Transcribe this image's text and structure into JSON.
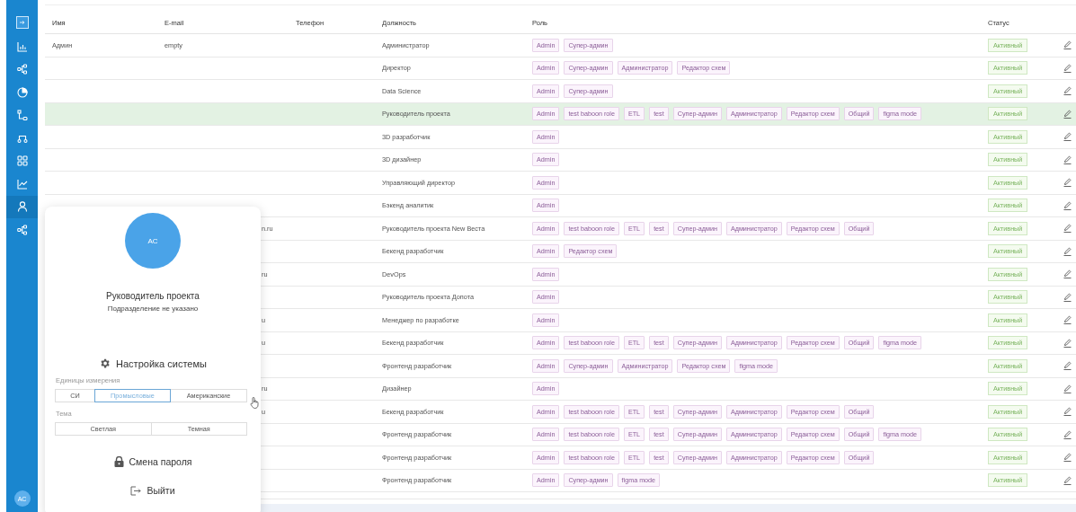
{
  "sidebar": {
    "items": [
      {
        "kind": "bar-chart",
        "selected": false
      },
      {
        "kind": "nodes",
        "selected": false
      },
      {
        "kind": "pie",
        "selected": false
      },
      {
        "kind": "flow",
        "selected": false
      },
      {
        "kind": "route",
        "selected": false
      },
      {
        "kind": "grid",
        "selected": false
      },
      {
        "kind": "line-chart",
        "selected": false
      },
      {
        "kind": "user",
        "selected": true
      },
      {
        "kind": "nodes",
        "selected": false
      }
    ],
    "avatar": "AC"
  },
  "table": {
    "columns": [
      "Имя",
      "E-mail",
      "Телефон",
      "Должность",
      "Роль",
      "Статус"
    ],
    "rows": [
      {
        "name": "Админ",
        "email": "empty",
        "position": "Администратор",
        "roles": [
          "Admin",
          "Супер-админ"
        ],
        "status": "Активный",
        "selected": false
      },
      {
        "position": "Директор",
        "roles": [
          "Admin",
          "Супер-админ",
          "Администратор",
          "Редактор схем"
        ],
        "status": "Активный",
        "selected": false
      },
      {
        "position": "Data Science",
        "roles": [
          "Admin",
          "Супер-админ"
        ],
        "status": "Активный",
        "selected": false
      },
      {
        "position": "Руководитель проекта",
        "roles": [
          "Admin",
          "test baboon role",
          "ETL",
          "test",
          "Супер-админ",
          "Администратор",
          "Редактор схем",
          "Общий",
          "figma mode"
        ],
        "status": "Активный",
        "selected": true
      },
      {
        "position": "3D разработчик",
        "roles": [
          "Admin"
        ],
        "status": "Активный",
        "selected": false
      },
      {
        "position": "3D дизайнер",
        "roles": [
          "Admin"
        ],
        "status": "Активный",
        "selected": false
      },
      {
        "position": "Управляющий директор",
        "roles": [
          "Admin"
        ],
        "status": "Активный",
        "selected": false
      },
      {
        "position": "Бэкенд аналитик",
        "roles": [
          "Admin"
        ],
        "status": "Активный",
        "selected": false
      },
      {
        "email_tail": "n.ru",
        "position": "Руководитель проекта New Веста",
        "roles": [
          "Admin",
          "test baboon role",
          "ETL",
          "test",
          "Супер-админ",
          "Администратор",
          "Редактор схем",
          "Общий"
        ],
        "status": "Активный",
        "selected": false
      },
      {
        "position": "Бекенд разработчик",
        "roles": [
          "Admin",
          "Редактор схем"
        ],
        "status": "Активный",
        "selected": false
      },
      {
        "email_tail": "ru",
        "position": "DevOps",
        "roles": [
          "Admin"
        ],
        "status": "Активный",
        "selected": false
      },
      {
        "position": "Руководитель проекта Допота",
        "roles": [
          "Admin"
        ],
        "status": "Активный",
        "selected": false
      },
      {
        "email_tail": "u",
        "position": "Менеджер по разработке",
        "roles": [
          "Admin"
        ],
        "status": "Активный",
        "selected": false
      },
      {
        "email_tail": "u",
        "position": "Бекенд разработчик",
        "roles": [
          "Admin",
          "test baboon role",
          "ETL",
          "test",
          "Супер-админ",
          "Администратор",
          "Редактор схем",
          "Общий",
          "figma mode"
        ],
        "status": "Активный",
        "selected": false
      },
      {
        "position": "Фронтенд разработчик",
        "roles": [
          "Admin",
          "Супер-админ",
          "Администратор",
          "Редактор схем",
          "figma mode"
        ],
        "status": "Активный",
        "selected": false
      },
      {
        "email_tail": "ru",
        "position": "Дизайнер",
        "roles": [
          "Admin"
        ],
        "status": "Активный",
        "selected": false
      },
      {
        "email_tail": "u",
        "position": "Бекенд разработчик",
        "roles": [
          "Admin",
          "test baboon role",
          "ETL",
          "test",
          "Супер-админ",
          "Администратор",
          "Редактор схем",
          "Общий"
        ],
        "status": "Активный",
        "selected": false
      },
      {
        "position": "Фронтенд разработчик",
        "roles": [
          "Admin",
          "test baboon role",
          "ETL",
          "test",
          "Супер-админ",
          "Администратор",
          "Редактор схем",
          "Общий",
          "figma mode"
        ],
        "status": "Активный",
        "selected": false
      },
      {
        "position": "Фронтенд разработчик",
        "roles": [
          "Admin",
          "test baboon role",
          "ETL",
          "test",
          "Супер-админ",
          "Администратор",
          "Редактор схем",
          "Общий"
        ],
        "status": "Активный",
        "selected": false
      },
      {
        "position": "Фронтенд разработчик",
        "roles": [
          "Admin",
          "Супер-админ",
          "figma mode"
        ],
        "status": "Активный",
        "selected": false
      }
    ]
  },
  "profile_popup": {
    "avatar": "AC",
    "title": "Руководитель проекта",
    "subtitle": "Подразделение не указано",
    "settings_title": "Настройка системы",
    "units_label": "Единицы измерения",
    "units": [
      {
        "label": "СИ",
        "selected": false
      },
      {
        "label": "Промысловые",
        "selected": true
      },
      {
        "label": "Американские",
        "selected": false
      }
    ],
    "theme_label": "Тема",
    "themes": [
      {
        "label": "Светлая",
        "selected": false
      },
      {
        "label": "Темная",
        "selected": false
      }
    ],
    "change_password": "Смена пароля",
    "logout": "Выйти"
  }
}
